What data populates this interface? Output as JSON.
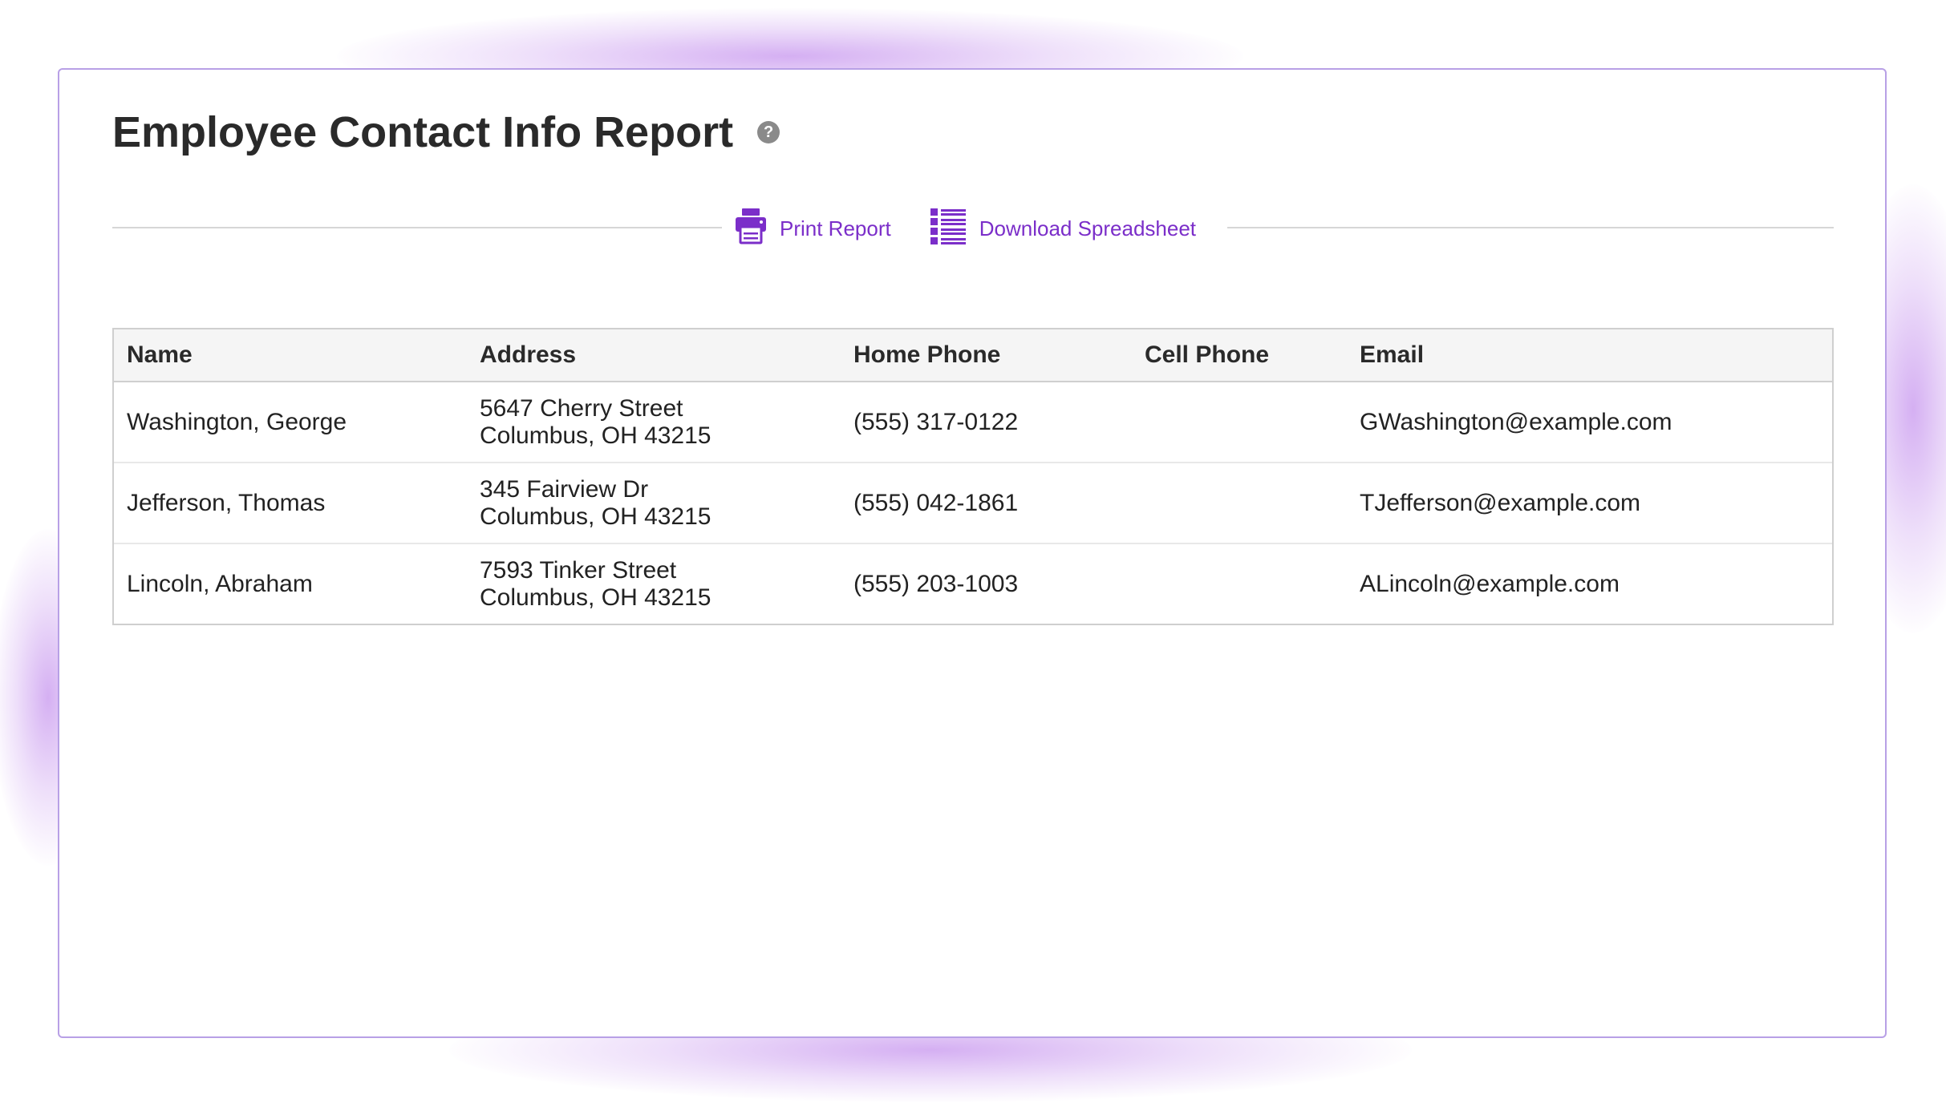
{
  "report": {
    "title": "Employee Contact Info Report",
    "help_glyph": "?"
  },
  "toolbar": {
    "print_label": "Print Report",
    "download_label": "Download Spreadsheet"
  },
  "table": {
    "headers": {
      "name": "Name",
      "address": "Address",
      "home_phone": "Home Phone",
      "cell_phone": "Cell Phone",
      "email": "Email"
    },
    "rows": [
      {
        "name": "Washington, George",
        "address_line1": "5647 Cherry Street",
        "address_line2": "Columbus, OH 43215",
        "home_phone": "(555) 317-0122",
        "cell_phone": "",
        "email": "GWashington@example.com"
      },
      {
        "name": "Jefferson, Thomas",
        "address_line1": "345 Fairview Dr",
        "address_line2": "Columbus, OH 43215",
        "home_phone": "(555) 042-1861",
        "cell_phone": "",
        "email": "TJefferson@example.com"
      },
      {
        "name": "Lincoln, Abraham",
        "address_line1": "7593 Tinker Street",
        "address_line2": "Columbus, OH 43215",
        "home_phone": "(555) 203-1003",
        "cell_phone": "",
        "email": "ALincoln@example.com"
      }
    ]
  },
  "theme": {
    "accent": "#7b2ec9",
    "card_border": "#b8a0e6",
    "glow": "#b26ee8"
  },
  "icons": {
    "help": "question-circle-icon",
    "print": "printer-icon",
    "download": "list-spreadsheet-icon"
  }
}
